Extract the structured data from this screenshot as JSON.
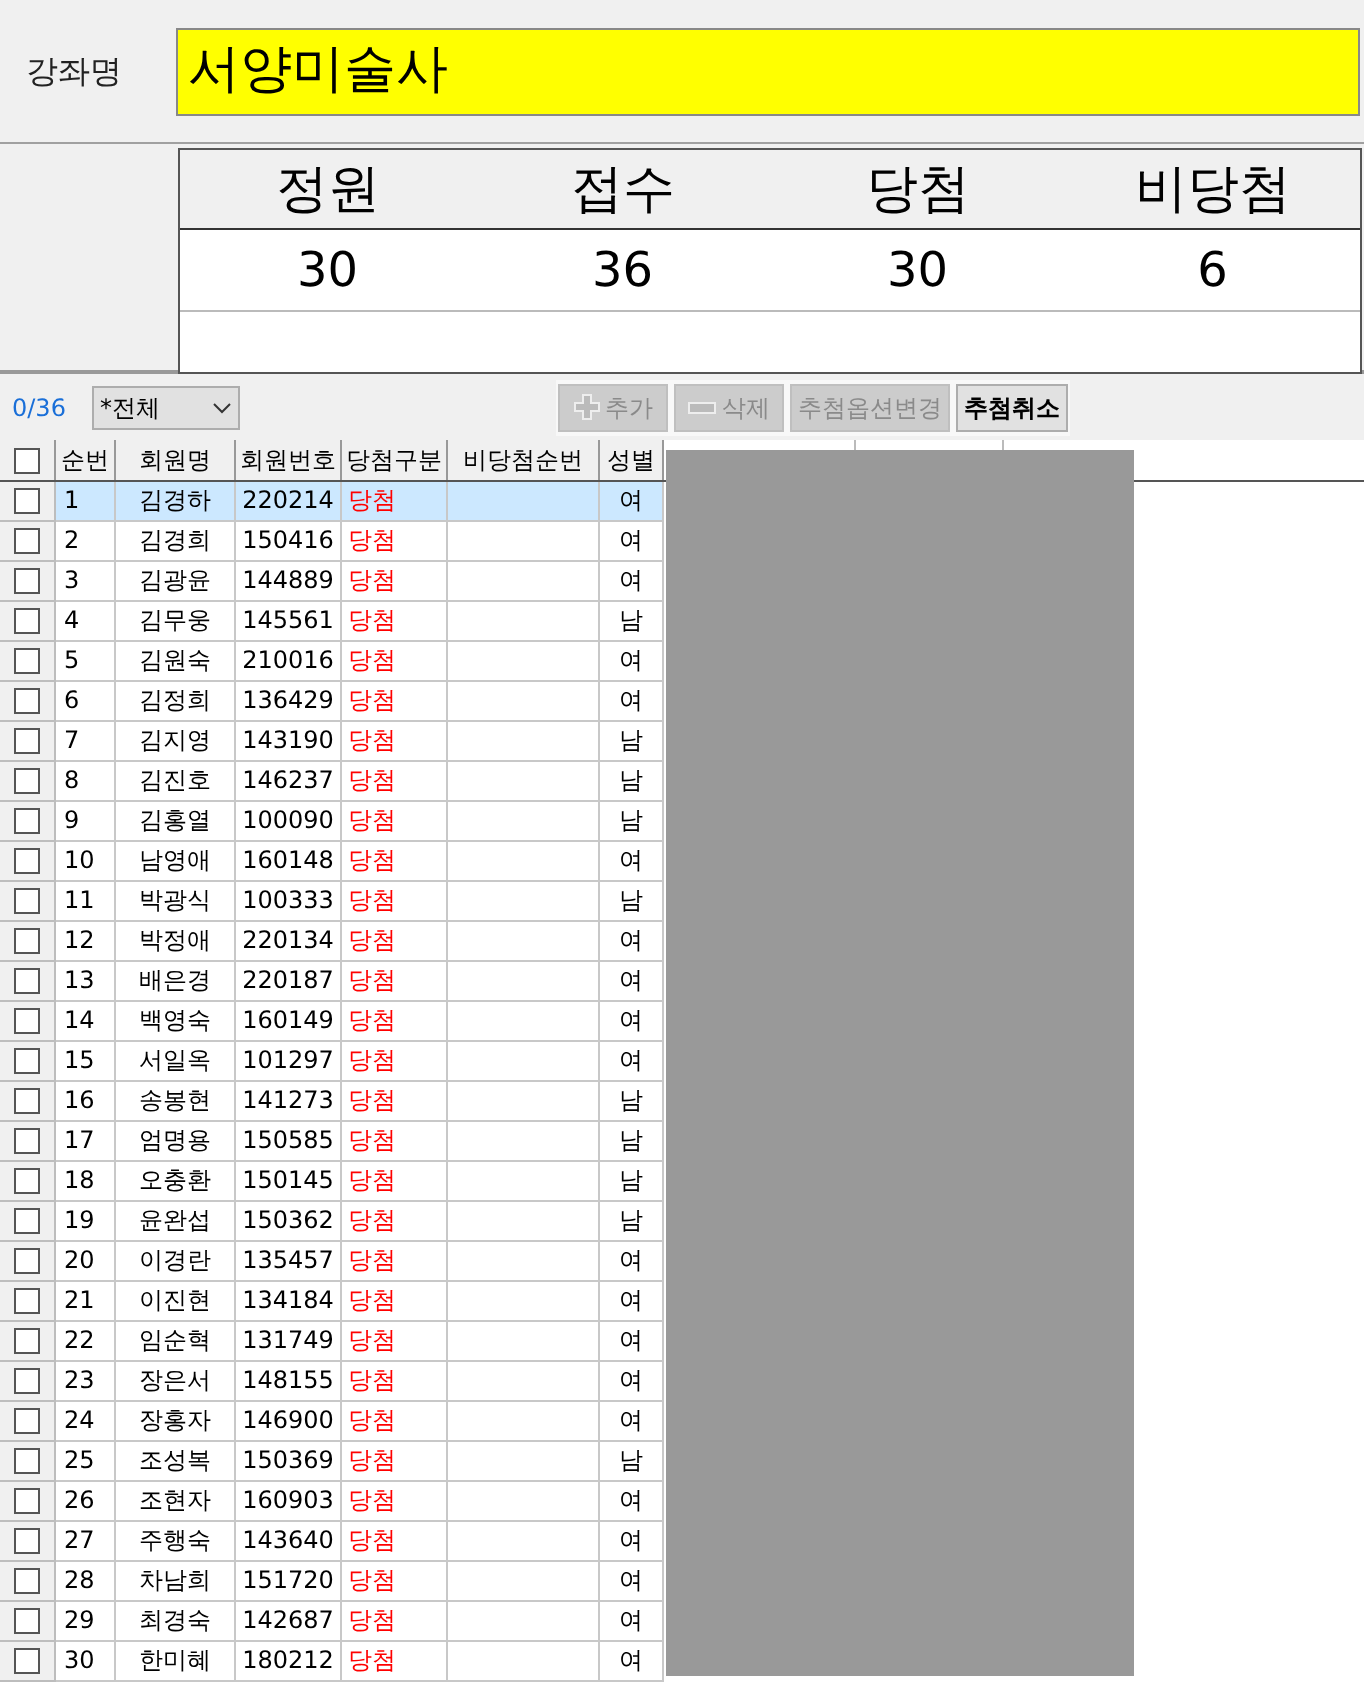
{
  "course": {
    "label": "강좌명",
    "value": "서양미술사"
  },
  "stats": {
    "headers": [
      "정원",
      "접수",
      "당첨",
      "비당첨"
    ],
    "values": [
      "30",
      "36",
      "30",
      "6"
    ]
  },
  "toolbar": {
    "count": "0/36",
    "filter": "*전체",
    "buttons": [
      {
        "label": "추가",
        "kind": "add",
        "disabled": true
      },
      {
        "label": "삭제",
        "kind": "remove",
        "disabled": true
      },
      {
        "label": "추첨옵션변경",
        "kind": "text",
        "disabled": true
      },
      {
        "label": "추첨취소",
        "kind": "text",
        "disabled": false
      }
    ]
  },
  "table": {
    "all_checked": false,
    "columns": [
      "순번",
      "회원명",
      "회원번호",
      "당첨구분",
      "비당첨순번",
      "성별"
    ],
    "rows": [
      {
        "no": "1",
        "name": "김경하",
        "id": "220214",
        "status": "당첨",
        "gender": "여",
        "selected": true,
        "checked": false
      },
      {
        "no": "2",
        "name": "김경희",
        "id": "150416",
        "status": "당첨",
        "gender": "여",
        "selected": false,
        "checked": false
      },
      {
        "no": "3",
        "name": "김광윤",
        "id": "144889",
        "status": "당첨",
        "gender": "여",
        "selected": false,
        "checked": false
      },
      {
        "no": "4",
        "name": "김무웅",
        "id": "145561",
        "status": "당첨",
        "gender": "남",
        "selected": false,
        "checked": false
      },
      {
        "no": "5",
        "name": "김원숙",
        "id": "210016",
        "status": "당첨",
        "gender": "여",
        "selected": false,
        "checked": false
      },
      {
        "no": "6",
        "name": "김정희",
        "id": "136429",
        "status": "당첨",
        "gender": "여",
        "selected": false,
        "checked": false
      },
      {
        "no": "7",
        "name": "김지영",
        "id": "143190",
        "status": "당첨",
        "gender": "남",
        "selected": false,
        "checked": false
      },
      {
        "no": "8",
        "name": "김진호",
        "id": "146237",
        "status": "당첨",
        "gender": "남",
        "selected": false,
        "checked": false
      },
      {
        "no": "9",
        "name": "김홍열",
        "id": "100090",
        "status": "당첨",
        "gender": "남",
        "selected": false,
        "checked": false
      },
      {
        "no": "10",
        "name": "남영애",
        "id": "160148",
        "status": "당첨",
        "gender": "여",
        "selected": false,
        "checked": false
      },
      {
        "no": "11",
        "name": "박광식",
        "id": "100333",
        "status": "당첨",
        "gender": "남",
        "selected": false,
        "checked": false
      },
      {
        "no": "12",
        "name": "박정애",
        "id": "220134",
        "status": "당첨",
        "gender": "여",
        "selected": false,
        "checked": false
      },
      {
        "no": "13",
        "name": "배은경",
        "id": "220187",
        "status": "당첨",
        "gender": "여",
        "selected": false,
        "checked": false
      },
      {
        "no": "14",
        "name": "백영숙",
        "id": "160149",
        "status": "당첨",
        "gender": "여",
        "selected": false,
        "checked": false
      },
      {
        "no": "15",
        "name": "서일옥",
        "id": "101297",
        "status": "당첨",
        "gender": "여",
        "selected": false,
        "checked": false
      },
      {
        "no": "16",
        "name": "송봉현",
        "id": "141273",
        "status": "당첨",
        "gender": "남",
        "selected": false,
        "checked": false
      },
      {
        "no": "17",
        "name": "엄명용",
        "id": "150585",
        "status": "당첨",
        "gender": "남",
        "selected": false,
        "checked": false
      },
      {
        "no": "18",
        "name": "오충환",
        "id": "150145",
        "status": "당첨",
        "gender": "남",
        "selected": false,
        "checked": false
      },
      {
        "no": "19",
        "name": "윤완섭",
        "id": "150362",
        "status": "당첨",
        "gender": "남",
        "selected": false,
        "checked": false
      },
      {
        "no": "20",
        "name": "이경란",
        "id": "135457",
        "status": "당첨",
        "gender": "여",
        "selected": false,
        "checked": false
      },
      {
        "no": "21",
        "name": "이진현",
        "id": "134184",
        "status": "당첨",
        "gender": "여",
        "selected": false,
        "checked": false
      },
      {
        "no": "22",
        "name": "임순혁",
        "id": "131749",
        "status": "당첨",
        "gender": "여",
        "selected": false,
        "checked": false
      },
      {
        "no": "23",
        "name": "장은서",
        "id": "148155",
        "status": "당첨",
        "gender": "여",
        "selected": false,
        "checked": false
      },
      {
        "no": "24",
        "name": "장홍자",
        "id": "146900",
        "status": "당첨",
        "gender": "여",
        "selected": false,
        "checked": false
      },
      {
        "no": "25",
        "name": "조성복",
        "id": "150369",
        "status": "당첨",
        "gender": "남",
        "selected": false,
        "checked": false
      },
      {
        "no": "26",
        "name": "조현자",
        "id": "160903",
        "status": "당첨",
        "gender": "여",
        "selected": false,
        "checked": false
      },
      {
        "no": "27",
        "name": "주행숙",
        "id": "143640",
        "status": "당첨",
        "gender": "여",
        "selected": false,
        "checked": false
      },
      {
        "no": "28",
        "name": "차남희",
        "id": "151720",
        "status": "당첨",
        "gender": "여",
        "selected": false,
        "checked": false
      },
      {
        "no": "29",
        "name": "최경숙",
        "id": "142687",
        "status": "당첨",
        "gender": "여",
        "selected": false,
        "checked": false
      },
      {
        "no": "30",
        "name": "한미혜",
        "id": "180212",
        "status": "당첨",
        "gender": "여",
        "selected": false,
        "checked": false
      }
    ]
  }
}
